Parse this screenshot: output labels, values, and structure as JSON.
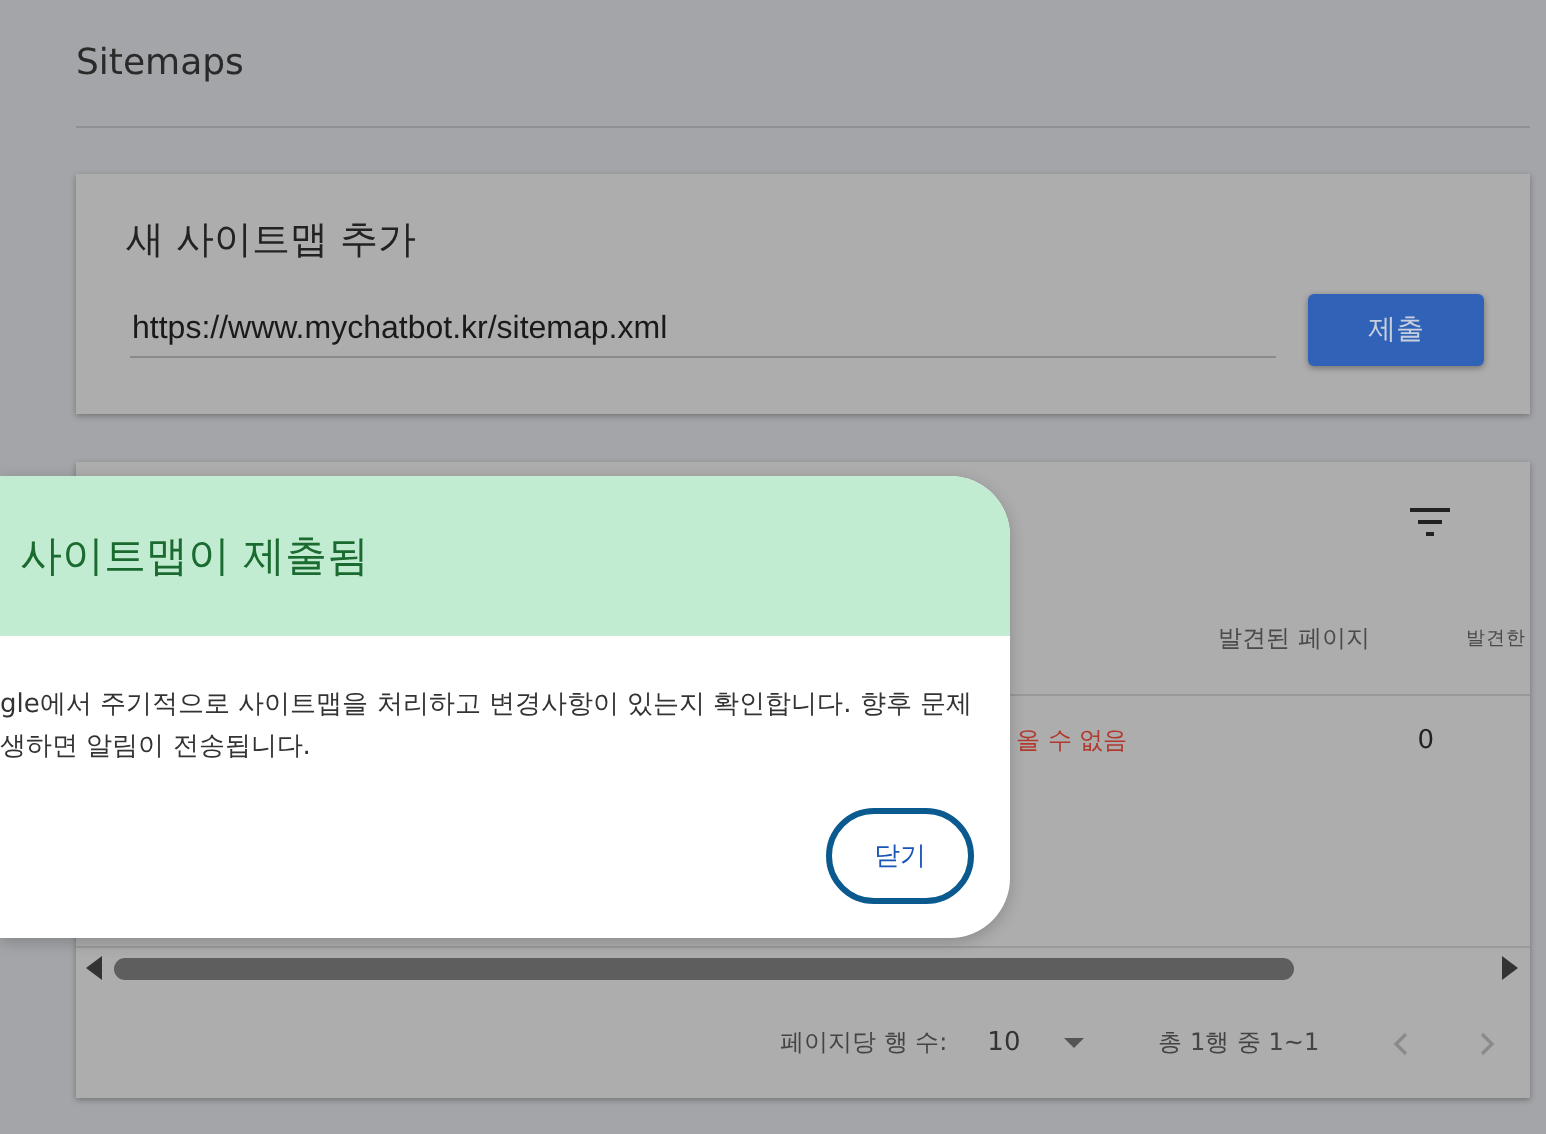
{
  "page": {
    "title": "Sitemaps"
  },
  "add_sitemap": {
    "title": "새 사이트맵 추가",
    "url": {
      "value": "https://www.mychatbot.kr/sitemap.xml"
    },
    "submit": "제출"
  },
  "table": {
    "columns": [
      {
        "label": "발견된 페이지"
      },
      {
        "label": "발견한"
      }
    ],
    "rows": [
      {
        "status": "올 수 없음",
        "pages": "0"
      }
    ],
    "footer": {
      "rows_per_page_label": "페이지당 행 수:",
      "rows_per_page": "10",
      "range": "총 1행 중 1~1"
    }
  },
  "dialog": {
    "title": "사이트맵이 제출됨",
    "lines": [
      "gle에서 주기적으로 사이트맵을 처리하고 변경사항이 있는지 확인합니다. 향후 문제",
      "생하면 알림이 전송됩니다."
    ],
    "button": "닫기"
  }
}
